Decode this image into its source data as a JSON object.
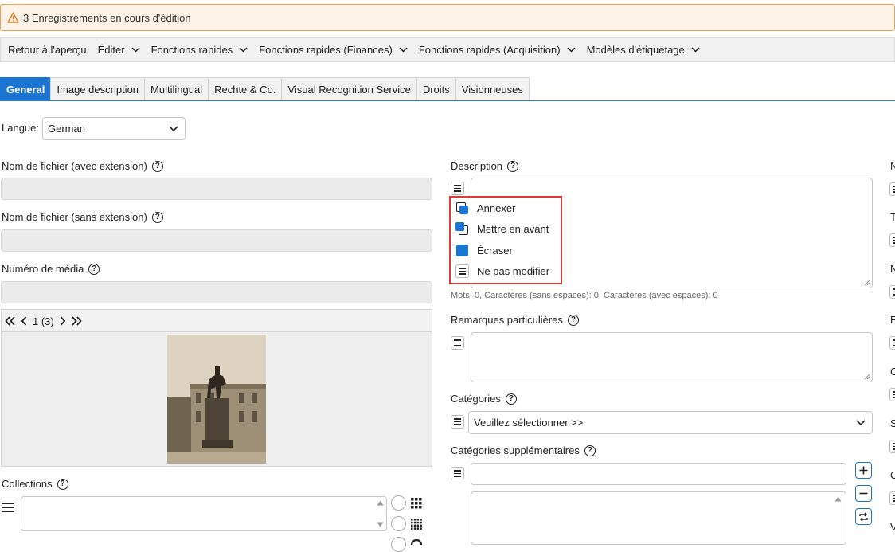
{
  "warning": {
    "text": "3 Enregistrements en cours d'édition",
    "color": "#e8a25a"
  },
  "menu": [
    {
      "label": "Retour à l'aperçu",
      "has_dropdown": false
    },
    {
      "label": "Éditer",
      "has_dropdown": true
    },
    {
      "label": "Fonctions rapides",
      "has_dropdown": true
    },
    {
      "label": "Fonctions rapides (Finances)",
      "has_dropdown": true
    },
    {
      "label": "Fonctions rapides (Acquisition)",
      "has_dropdown": true
    },
    {
      "label": "Modèles d'étiquetage",
      "has_dropdown": true
    }
  ],
  "tabs": [
    {
      "label": "General",
      "active": true
    },
    {
      "label": "Image description",
      "active": false
    },
    {
      "label": "Multilingual",
      "active": false
    },
    {
      "label": "Rechte & Co.",
      "active": false
    },
    {
      "label": "Visual Recognition Service",
      "active": false
    },
    {
      "label": "Droits",
      "active": false
    },
    {
      "label": "Visionneuses",
      "active": false
    }
  ],
  "langue": {
    "label": "Langue:",
    "value": "German"
  },
  "left": {
    "filename_ext_label": "Nom de fichier (avec extension)",
    "filename_noext_label": "Nom de fichier (sans extension)",
    "media_number_label": "Numéro de média",
    "pager": {
      "page": "1 (3)"
    },
    "collections_label": "Collections"
  },
  "right": {
    "description_label": "Description",
    "description_counter": "Mots: 0, Caractères (sans espaces): 0, Caractères (avec espaces): 0",
    "remarks_label": "Remarques particulières",
    "categories_label": "Catégories",
    "categories_value": "Veuillez sélectionner >>",
    "extra_categories_label": "Catégories supplémentaires"
  },
  "popup_menu": [
    {
      "label": "Annexer",
      "icon": "append-icon"
    },
    {
      "label": "Mettre en avant",
      "icon": "prepend-icon"
    },
    {
      "label": "Écraser",
      "icon": "overwrite-icon"
    },
    {
      "label": "Ne pas modifier",
      "icon": "list-icon"
    }
  ],
  "edge_letters": [
    "N",
    "T",
    "N",
    "E",
    "C",
    "S",
    "C",
    "V"
  ],
  "colors": {
    "accent": "#1a76d2",
    "highlight": "#e0393c"
  }
}
